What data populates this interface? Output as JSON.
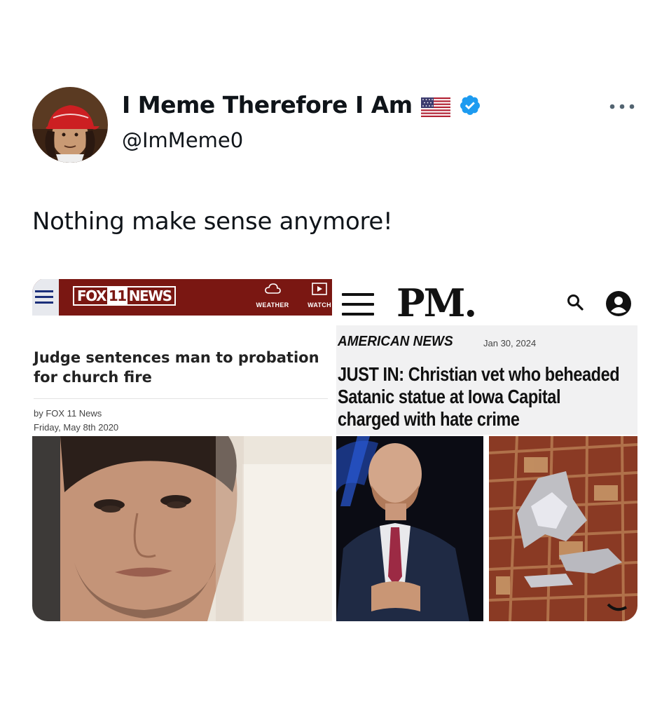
{
  "tweet": {
    "author": {
      "display_name": "I Meme Therefore I Am",
      "handle": "@ImMeme0",
      "flag_icon": "us-flag-icon",
      "verified_icon": "verified-badge-icon",
      "avatar_icon": "portrait-with-red-cap-avatar"
    },
    "more_icon": "more-options-icon",
    "text": "Nothing make sense anymore!"
  },
  "media": {
    "left": {
      "logo_prefix": "FOX",
      "logo_number": "11",
      "logo_suffix": "NEWS",
      "nav": {
        "weather": "WEATHER",
        "watch": "WATCH"
      },
      "headline": "Judge sentences man to probation for church fire",
      "byline_author": "by FOX 11 News",
      "byline_date": "Friday, May 8th 2020"
    },
    "right": {
      "logo": "PM.",
      "section": "AMERICAN NEWS",
      "date": "Jan 30, 2024",
      "headline_lines": [
        "JUST IN: Christian vet who beheaded",
        "Satanic statue at Iowa Capital",
        "charged with hate crime"
      ]
    }
  },
  "colors": {
    "fox_red": "#7a1712",
    "verified_blue": "#1d9bf0",
    "text_primary": "#0f1419"
  }
}
